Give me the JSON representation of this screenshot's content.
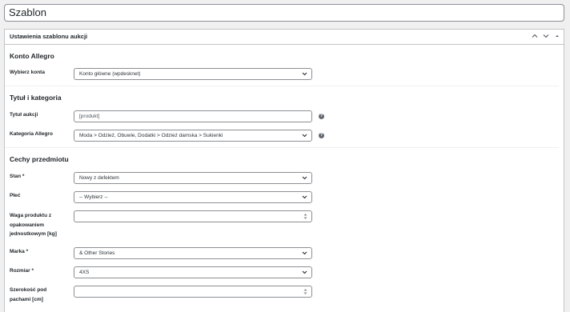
{
  "title_field": {
    "value": "Szablon"
  },
  "metabox": {
    "title": "Ustawienia szablonu aukcji",
    "controls": [
      "chevron-up-icon",
      "chevron-down-icon",
      "triangle-up-icon"
    ]
  },
  "sections": {
    "account": {
      "title": "Konto Allegro",
      "choose_account_label": "Wybierz konta",
      "choose_account_value": "Konto główne (wpdesknet)"
    },
    "title_category": {
      "title": "Tytuł i kategoria",
      "auction_title_label": "Tytuł aukcji",
      "auction_title_value": "[produkt]",
      "category_label": "Kategoria Allegro",
      "category_value": "Moda > Odzież, Obuwie, Dodatki > Odzież damska > Sukienki",
      "help_glyph": "?"
    },
    "attributes": {
      "title": "Cechy przedmiotu",
      "condition_label": "Stan *",
      "condition_value": "Nowy z defektem",
      "gender_label": "Płeć",
      "gender_value": "-- Wybierz --",
      "weight_label": "Waga produktu z opakowaniem jednostkowym [kg]",
      "weight_value": "",
      "brand_label": "Marka *",
      "brand_value": "& Other Stories",
      "size_label": "Rozmiar *",
      "size_value": "4XS",
      "armpit_label": "Szerokość pod pachami [cm]",
      "armpit_value": ""
    }
  },
  "colors": {
    "border": "#8c8f94",
    "help_icon": "#646970",
    "background": "#f0f0f1"
  }
}
